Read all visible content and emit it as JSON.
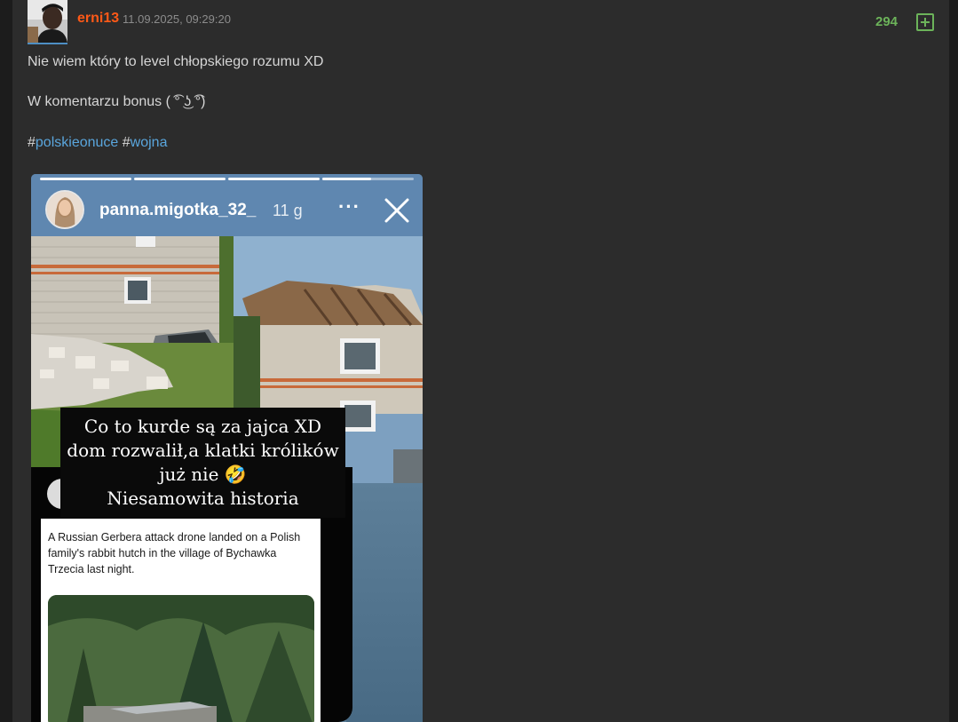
{
  "post": {
    "author": "erni13",
    "timestamp": "11.09.2025, 09:29:20",
    "votes": "294",
    "plus_icon": "plus-square-icon",
    "body_lines": [
      "Nie wiem który to level chłopskiego rozumu XD",
      "W komentarzu bonus ( ͡° ͜ʖ ͡°)"
    ],
    "tags": [
      {
        "hash": "#",
        "label": "polskieonuce"
      },
      {
        "hash": "#",
        "label": "wojna"
      }
    ]
  },
  "story": {
    "username": "panna.migotka_32_",
    "age": "11 g",
    "more_label": "···",
    "close_icon": "close-icon",
    "caption_lines": [
      "Co to kurde są za jajca XD",
      "dom rozwalił,a klatki królików",
      "już nie 🤣",
      "Niesamowita historia"
    ],
    "tweet_text": "A Russian Gerbera attack drone landed on a Polish family's rabbit hutch in the village of Bychawka Trzecia last night."
  },
  "colors": {
    "background": "#2c2c2c",
    "author": "#ff5917",
    "votes": "#6cb35a",
    "tag": "#5aa6dd"
  }
}
